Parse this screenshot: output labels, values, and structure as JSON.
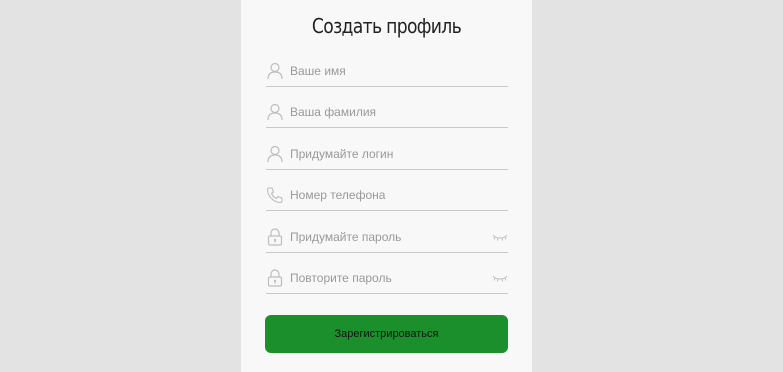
{
  "form": {
    "title": "Создать профиль",
    "fields": [
      {
        "placeholder": "Ваше имя",
        "icon": "user-icon"
      },
      {
        "placeholder": "Ваша фамилия",
        "icon": "user-icon"
      },
      {
        "placeholder": "Придумайте логин",
        "icon": "user-icon"
      },
      {
        "placeholder": "Номер телефона",
        "icon": "phone-icon"
      },
      {
        "placeholder": "Придумайте пароль",
        "icon": "lock-icon",
        "toggle_icon": "eye-closed-icon"
      },
      {
        "placeholder": "Повторите пароль",
        "icon": "lock-icon",
        "toggle_icon": "eye-closed-icon"
      }
    ],
    "submit_label": "Зарегистрироваться"
  },
  "colors": {
    "background": "#e3e3e3",
    "card": "#f8f8f8",
    "accent": "#1a8f2c",
    "icon": "#bdbdbd"
  }
}
